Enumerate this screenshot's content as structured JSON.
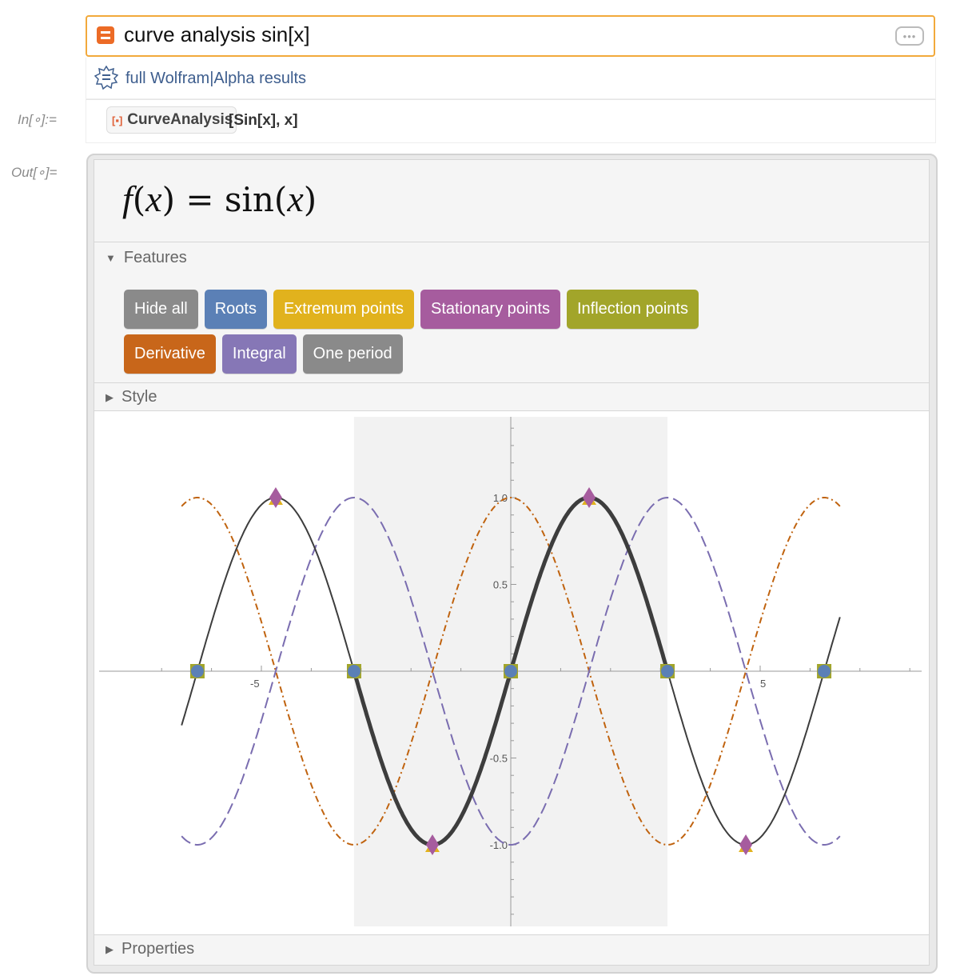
{
  "input_bar": {
    "query": "curve analysis sin[x]",
    "icon": "wolfram-alpha-equals-icon",
    "more_label": "•••"
  },
  "full_results": {
    "label": "full Wolfram|Alpha results",
    "icon": "wolfram-star-icon"
  },
  "input_cell": {
    "label": "In[∘]:=",
    "function_name": "CurveAnalysis",
    "function_icon": "[▪]",
    "arguments": "[Sin[x],  x]"
  },
  "output_cell": {
    "label": "Out[∘]=",
    "formula": {
      "lhs_f": "f",
      "lhs_open": "(",
      "lhs_x": "x",
      "lhs_close": ")",
      "eq": " = sin(",
      "rhs_x": "x",
      "rhs_close": ")"
    },
    "features": {
      "title": "Features",
      "expanded": true,
      "buttons": [
        {
          "label": "Hide all",
          "color": "#8a8a8a"
        },
        {
          "label": "Roots",
          "color": "#5b80b6"
        },
        {
          "label": "Extremum points",
          "color": "#e1b21d"
        },
        {
          "label": "Stationary points",
          "color": "#a65c9e"
        },
        {
          "label": "Inflection points",
          "color": "#a2a52a"
        },
        {
          "label": "Derivative",
          "color": "#c8661a"
        },
        {
          "label": "Integral",
          "color": "#8677b6"
        },
        {
          "label": "One period",
          "color": "#8a8a8a"
        }
      ]
    },
    "style": {
      "title": "Style",
      "expanded": false
    },
    "properties": {
      "title": "Properties",
      "expanded": false
    }
  },
  "chart_data": {
    "type": "line",
    "xlim": [
      -6.6,
      6.6
    ],
    "ylim": [
      -1.47,
      1.47
    ],
    "x_tick_labels": [
      "-5",
      "5"
    ],
    "y_tick_labels": [
      "1.0",
      "0.5",
      "-0.5",
      "-1.0"
    ],
    "x_ticks": [
      -5,
      5
    ],
    "y_ticks": [
      1.0,
      0.5,
      -0.5,
      -1.0
    ],
    "highlighted_period": [
      -3.14159,
      3.14159
    ],
    "series": [
      {
        "function": "sin(x)",
        "style": "solid",
        "color": "#3d3d3d"
      },
      {
        "function": "cos(x)",
        "style": "dot-dash",
        "color": "#c0630f"
      },
      {
        "function": "-cos(x)",
        "style": "dashed",
        "color": "#7a6db0"
      }
    ],
    "roots": [
      -6.28319,
      -3.14159,
      0,
      3.14159,
      6.28319
    ],
    "inflection_points": [
      [
        -6.28319,
        0
      ],
      [
        -3.14159,
        0
      ],
      [
        0,
        0
      ],
      [
        3.14159,
        0
      ],
      [
        6.28319,
        0
      ]
    ],
    "maxima": [
      [
        -4.71239,
        1
      ],
      [
        1.5708,
        1
      ]
    ],
    "minima": [
      [
        -1.5708,
        -1
      ],
      [
        4.71239,
        -1
      ]
    ],
    "marker_colors": {
      "root": "#5b80b6",
      "inflection": "#a2a52a",
      "stationary": "#a65c9e",
      "extremum": "#e1b21d"
    }
  }
}
